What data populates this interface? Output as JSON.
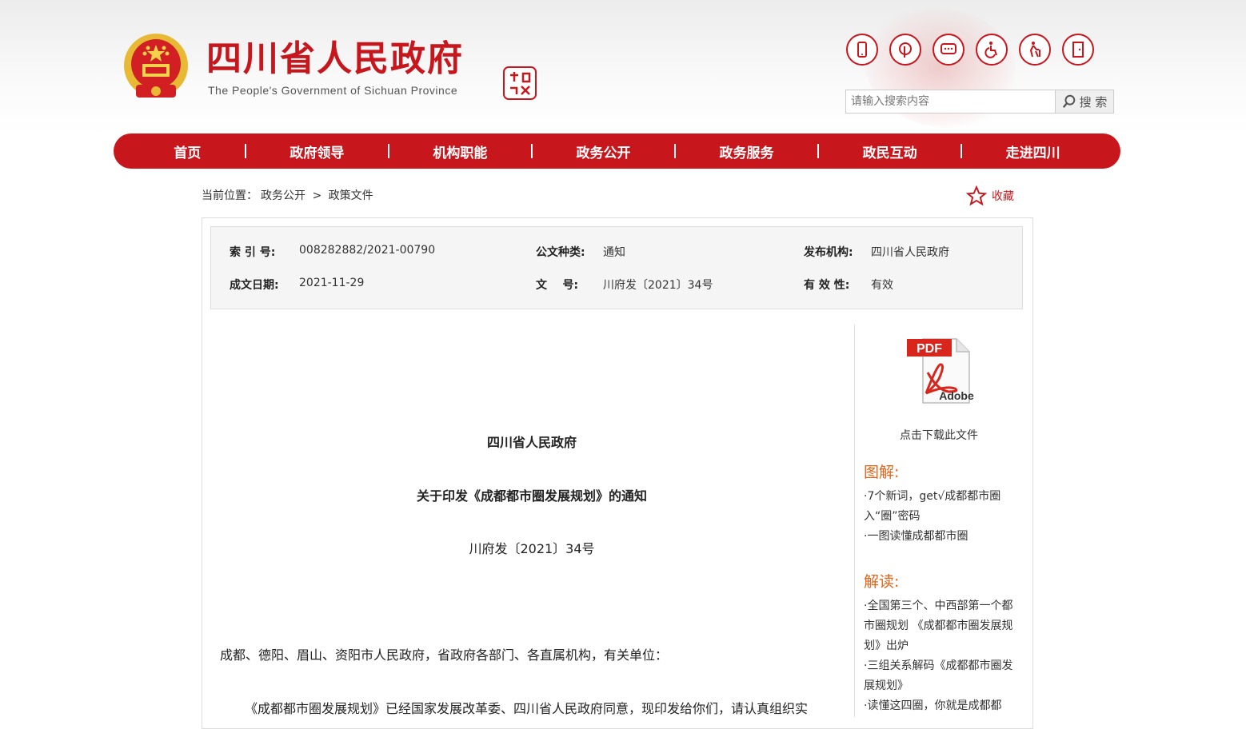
{
  "header": {
    "title": "四川省人民政府",
    "subtitle": "The People's Government of Sichuan Province"
  },
  "tools": [
    {
      "icon": "mobile-icon"
    },
    {
      "icon": "pinterest-icon"
    },
    {
      "icon": "message-icon"
    },
    {
      "icon": "accessibility-icon"
    },
    {
      "icon": "elderly-icon"
    },
    {
      "icon": "exit-icon"
    }
  ],
  "search": {
    "placeholder": "请输入搜索内容",
    "button_label": "搜 索"
  },
  "nav": {
    "items": [
      "首页",
      "政府领导",
      "机构职能",
      "政务公开",
      "政务服务",
      "政民互动",
      "走进四川"
    ]
  },
  "breadcrumb": {
    "prefix": "当前位置：",
    "level1": "政务公开",
    "sep": ">",
    "level2": "政策文件"
  },
  "favorite": {
    "label": "收藏"
  },
  "meta": {
    "index_label": "索 引 号:",
    "index_value": "008282882/2021-00790",
    "type_label": "公文种类:",
    "type_value": "通知",
    "org_label": "发布机构:",
    "org_value": "四川省人民政府",
    "date_label": "成文日期:",
    "date_value": "2021-11-29",
    "docno_label": "文    号:",
    "docno_value": "川府发〔2021〕34号",
    "validity_label": "有 效 性:",
    "validity_value": "有效"
  },
  "document": {
    "org": "四川省人民政府",
    "title": "关于印发《成都都市圈发展规划》的通知",
    "number": "川府发〔2021〕34号",
    "recipients": "成都、德阳、眉山、资阳市人民政府，省政府各部门、各直属机构，有关单位：",
    "body": "《成都都市圈发展规划》已经国家发展改革委、四川省人民政府同意，现印发给你们，请认真组织实"
  },
  "sidebar": {
    "pdf_caption": "点击下载此文件",
    "pdf_tag": "PDF",
    "pdf_brand": "Adobe",
    "tujie_heading": "图解:",
    "tujie_links": [
      "·7个新词，get√成都都市圈入“圈”密码",
      "·一图读懂成都都市圈"
    ],
    "jiedu_heading": "解读:",
    "jiedu_links": [
      "·全国第三个、中西部第一个都市圈规划 《成都都市圈发展规划》出炉",
      "·三组关系解码《成都都市圈发展规划》",
      "·读懂这四圈，你就是成都都"
    ]
  },
  "colors": {
    "brand_red": "#c8161d",
    "heading_orange": "#e0661d"
  }
}
